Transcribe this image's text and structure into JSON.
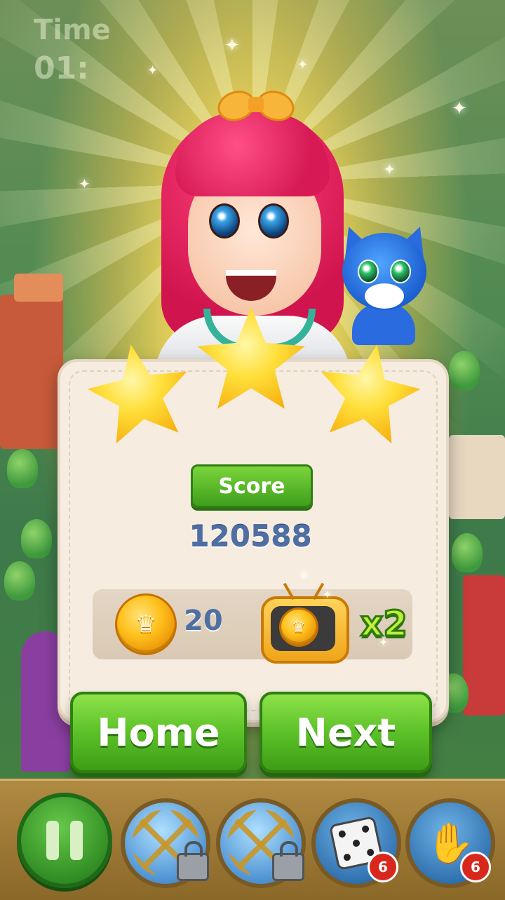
{
  "hud": {
    "timer_label": "Time",
    "timer_value": "01:"
  },
  "result": {
    "stars_earned": 3,
    "stars_total": 3,
    "score_label": "Score",
    "score_value": "120588",
    "coin_reward": "20",
    "ad_multiplier": "x2"
  },
  "buttons": {
    "home_label": "Home",
    "next_label": "Next"
  },
  "boosters": [
    {
      "name": "booster-1",
      "locked": true
    },
    {
      "name": "booster-2",
      "locked": true
    },
    {
      "name": "dice",
      "count": "6",
      "icon": "dice-icon"
    },
    {
      "name": "glove",
      "count": "6",
      "icon": "glove-icon"
    }
  ],
  "colors": {
    "primary_green": "#5cc128",
    "star_gold": "#ffc21d",
    "score_text": "#4f6fa3"
  }
}
